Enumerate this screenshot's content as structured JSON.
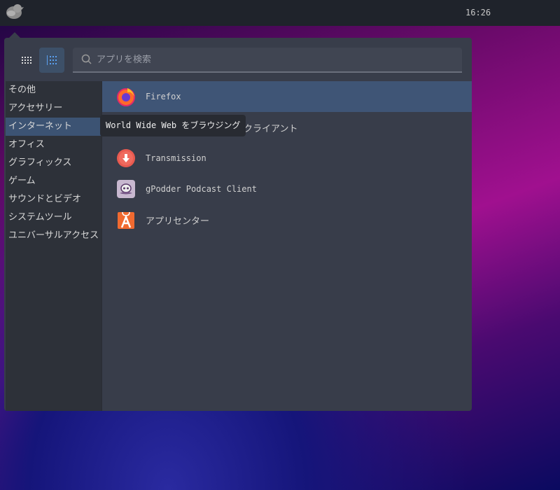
{
  "topbar": {
    "clock": "16:26"
  },
  "menu": {
    "search_placeholder": "アプリを検索",
    "categories": [
      "その他",
      "アクセサリー",
      "インターネット",
      "オフィス",
      "グラフィックス",
      "ゲーム",
      "サウンドとビデオ",
      "システムツール",
      "ユニバーサルアクセス"
    ],
    "selected_category": "インターネット",
    "apps": [
      {
        "name": "Firefox",
        "icon": "firefox-icon"
      },
      {
        "name": "クライアント",
        "icon": "client-icon"
      },
      {
        "name": "Transmission",
        "icon": "transmission-icon"
      },
      {
        "name": "gPodder Podcast Client",
        "icon": "gpodder-icon"
      },
      {
        "name": "アプリセンター",
        "icon": "app-center-icon"
      }
    ],
    "tooltip": "World Wide Web をブラウジング"
  }
}
